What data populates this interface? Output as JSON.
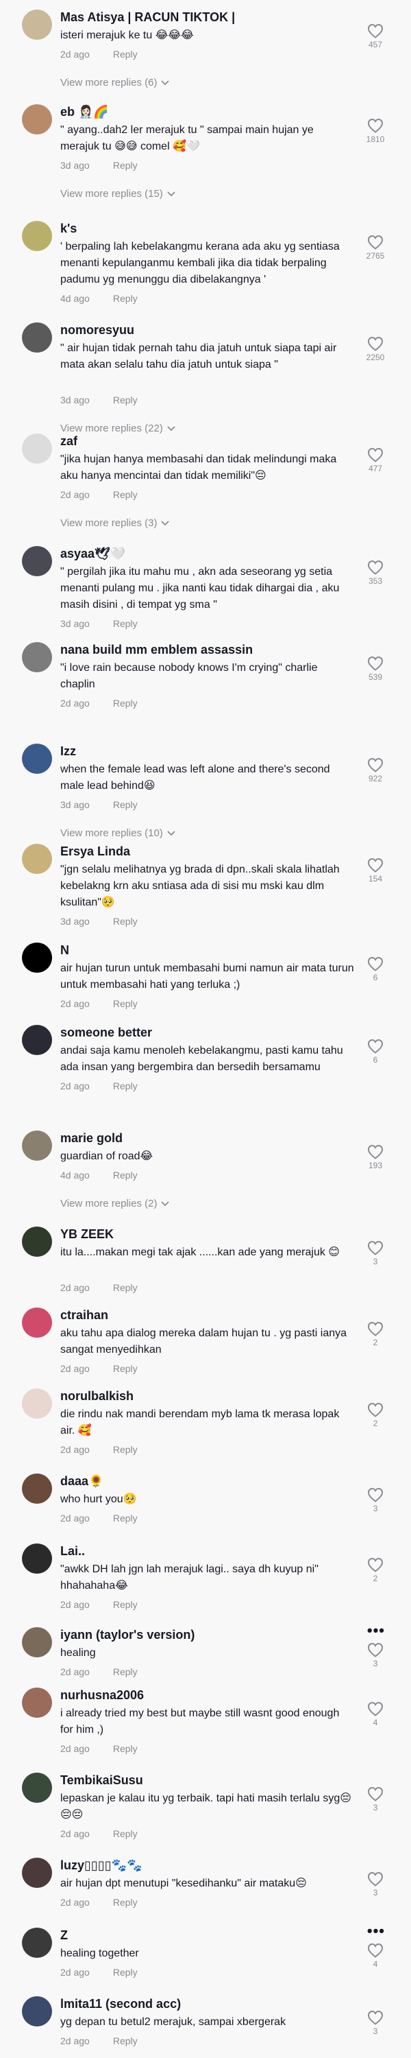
{
  "ui": {
    "reply_label": "Reply",
    "accent": "#fe2c55",
    "muted_text_color": "#8a8b91",
    "background": "#f8f8f8"
  },
  "comments": [
    {
      "username": "Mas Atisya | RACUN TIKTOK |",
      "text": "isteri merajuk ke tu 😂😂😂",
      "time": "2d ago",
      "likes": "457",
      "avatar_color": "#c9b89a",
      "view_more": "View more replies (6)"
    },
    {
      "username": "eb 👩🏻‍⚕️🌈",
      "text": "\" ayang..dah2 ler merajuk tu \" sampai main hujan ye merajuk tu 😅😅 comel 🥰🤍",
      "time": "3d ago",
      "likes": "1810",
      "avatar_color": "#b98a6a",
      "view_more": "View more replies (15)"
    },
    {
      "username": "k's",
      "text": "' berpaling lah kebelakangmu kerana ada aku yg sentiasa menanti kepulanganmu kembali jika dia tidak berpaling padumu yg menunggu dia dibelakangnya '",
      "time": "4d ago",
      "likes": "2765",
      "avatar_color": "#b8b06a",
      "view_more": ""
    },
    {
      "username": "nomoresyuu",
      "text": "\" air hujan tidak pernah tahu dia jatuh untuk siapa tapi air mata akan selalu tahu dia jatuh untuk siapa \"",
      "time": "3d ago",
      "likes": "2250",
      "avatar_color": "#5a5a5a",
      "view_more": "View more replies (22)"
    },
    {
      "username": "zaf",
      "text": "\"jika hujan hanya membasahi dan tidak melindungi maka aku hanya mencintai dan tidak memiliki\"😔",
      "time": "2d ago",
      "likes": "477",
      "avatar_color": "#dcdcdc",
      "view_more": "View more replies (3)"
    },
    {
      "username": "asyaa🕊🤍",
      "text": "\" pergilah jika itu mahu mu , akn ada seseorang yg setia menanti pulang mu . jika nanti kau tidak dihargai dia , aku masih disini , di tempat yg sma \"",
      "time": "3d ago",
      "likes": "353",
      "avatar_color": "#4a4a55",
      "view_more": ""
    },
    {
      "username": "nana build mm emblem assassin",
      "text": "\"i love rain because nobody knows I'm crying\" charlie chaplin",
      "time": "2d ago",
      "likes": "539",
      "avatar_color": "#7c7c7c",
      "view_more": ""
    },
    {
      "username": "Izz",
      "text": "when the female lead was left alone and there's second male lead behind😆",
      "time": "3d ago",
      "likes": "922",
      "avatar_color": "#3a5a8c",
      "view_more": "View more replies (10)"
    },
    {
      "username": "Ersya Linda",
      "text": "\"jgn selalu melihatnya yg brada di dpn..skali skala lihatlah kebelakng krn aku sntiasa ada di sisi mu mski kau dlm ksulitan\"🥺",
      "time": "3d ago",
      "likes": "154",
      "avatar_color": "#c8b27a",
      "view_more": ""
    },
    {
      "username": "N",
      "text": "air hujan turun untuk membasahi bumi namun air mata turun untuk membasahi hati yang terluka ;)",
      "time": "2d ago",
      "likes": "6",
      "avatar_color": "#000000",
      "view_more": ""
    },
    {
      "username": "someone better",
      "text": "andai saja kamu menoleh kebelakangmu, pasti kamu tahu ada insan yang bergembira dan bersedih bersamamu",
      "time": "2d ago",
      "likes": "6",
      "avatar_color": "#2a2a35",
      "view_more": ""
    },
    {
      "username": "marie gold",
      "text": "guardian of road😂",
      "time": "4d ago",
      "likes": "193",
      "avatar_color": "#8a8070",
      "view_more": "View more replies (2)"
    },
    {
      "username": "YB ZEEK",
      "text": "itu la....makan megi tak ajak ......kan ade yang merajuk 😊",
      "time": "2d ago",
      "likes": "3",
      "avatar_color": "#2f3a2a",
      "view_more": ""
    },
    {
      "username": "ctraihan",
      "text": "aku tahu apa dialog mereka dalam hujan tu . yg pasti ianya sangat menyedihkan",
      "time": "2d ago",
      "likes": "2",
      "avatar_color": "#d04a6a",
      "view_more": ""
    },
    {
      "username": "norulbalkish",
      "text": "die rindu nak mandi berendam myb lama tk merasa lopak air. 🥰",
      "time": "2d ago",
      "likes": "2",
      "avatar_color": "#e8d6d0",
      "view_more": ""
    },
    {
      "username": "daaa🌻",
      "text": "who hurt you🥺",
      "time": "2d ago",
      "likes": "3",
      "avatar_color": "#6a4a3a",
      "view_more": ""
    },
    {
      "username": "Lai..",
      "text": "\"awkk DH lah jgn lah merajuk lagi.. saya dh kuyup ni\" hhahahaha😂",
      "time": "2d ago",
      "likes": "2",
      "avatar_color": "#2a2a2a",
      "view_more": ""
    },
    {
      "username": "iyann (taylor's version)",
      "text": "healing",
      "time": "2d ago",
      "likes": "3",
      "avatar_color": "#7a6a5a",
      "view_more": "",
      "dots": true
    },
    {
      "username": "nurhusna2006",
      "text": "i already tried my best but maybe still wasnt good enough for him ,)",
      "time": "2d ago",
      "likes": "4",
      "avatar_color": "#9a6a5a",
      "view_more": ""
    },
    {
      "username": "TembikaiSusu",
      "text": "lepaskan je kalau itu yg terbaik. tapi hati masih terlalu syg😔😔😔",
      "time": "2d ago",
      "likes": "3",
      "avatar_color": "#3a4a3a",
      "view_more": ""
    },
    {
      "username": "luzy▯▯▯▯🐾🐾",
      "text": "air hujan dpt menutupi \"kesedihanku\" air mataku😔",
      "time": "2d ago",
      "likes": "3",
      "avatar_color": "#4a3a3a",
      "view_more": ""
    },
    {
      "username": "Z",
      "text": "healing together",
      "time": "2d ago",
      "likes": "4",
      "avatar_color": "#3a3a3a",
      "view_more": "",
      "dots": true
    },
    {
      "username": "lmita11 (second acc)",
      "text": "yg depan tu betul2 merajuk, sampai xbergerak",
      "time": "2d ago",
      "likes": "3",
      "avatar_color": "#3a4a6a",
      "view_more": ""
    }
  ]
}
